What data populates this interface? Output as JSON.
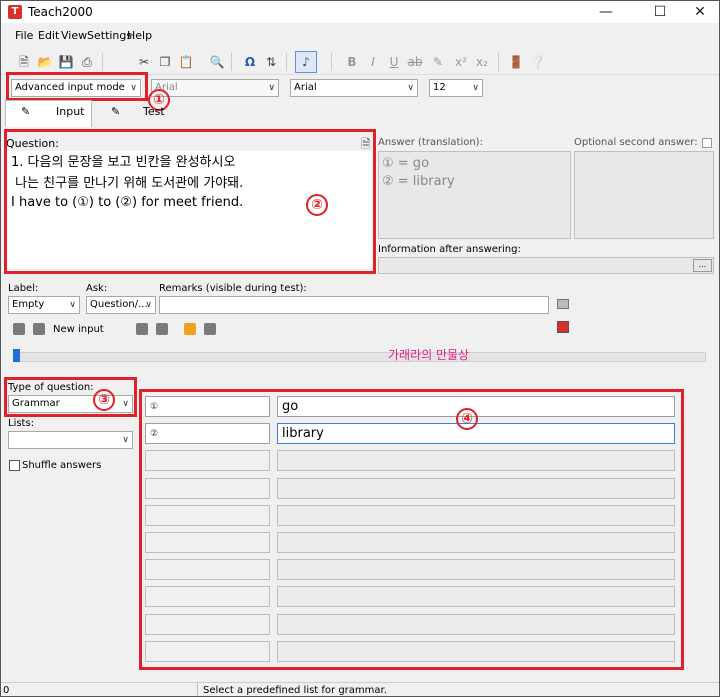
{
  "window": {
    "title": "Teach2000",
    "app_icon": "T"
  },
  "menu": [
    "File",
    "Edit",
    "View",
    "Settings",
    "Help"
  ],
  "toolbar": {
    "mode_select": "Advanced input mode",
    "font_question": "Arial",
    "font_answer": "Arial",
    "font_size": "12"
  },
  "tabs": {
    "input": "Input",
    "test": "Test"
  },
  "question": {
    "label": "Question:",
    "lines": [
      "1. 다음의 문장을 보고 빈칸을 완성하시오",
      " 나는 친구를 만나기 위해 도서관에 가야돼.",
      "I have to (①) to (②) for meet friend."
    ]
  },
  "answer": {
    "label": "Answer (translation):",
    "lines": [
      "① = go",
      "② = library"
    ],
    "optional_label": "Optional second answer:",
    "info_label": "Information after answering:",
    "info_button": "..."
  },
  "meta": {
    "label_caption": "Label:",
    "label_value": "Empty",
    "ask_caption": "Ask:",
    "ask_value": "Question/...",
    "remarks_caption": "Remarks (visible during test):",
    "new_input": "New input",
    "watermark": "가래라의 만물상"
  },
  "left": {
    "type_caption": "Type of question:",
    "type_value": "Grammar",
    "lists_caption": "Lists:",
    "shuffle_label": "Shuffle answers"
  },
  "grid": {
    "rows": [
      {
        "num": "①",
        "value": "go"
      },
      {
        "num": "②",
        "value": "library"
      }
    ]
  },
  "annotations": [
    "①",
    "②",
    "③",
    "④"
  ],
  "status": {
    "left": "0",
    "text": "Select a predefined list for grammar."
  },
  "colors": {
    "highlight": "#e0202a",
    "slider": "#1e6fd9",
    "watermark": "#e0208a"
  }
}
